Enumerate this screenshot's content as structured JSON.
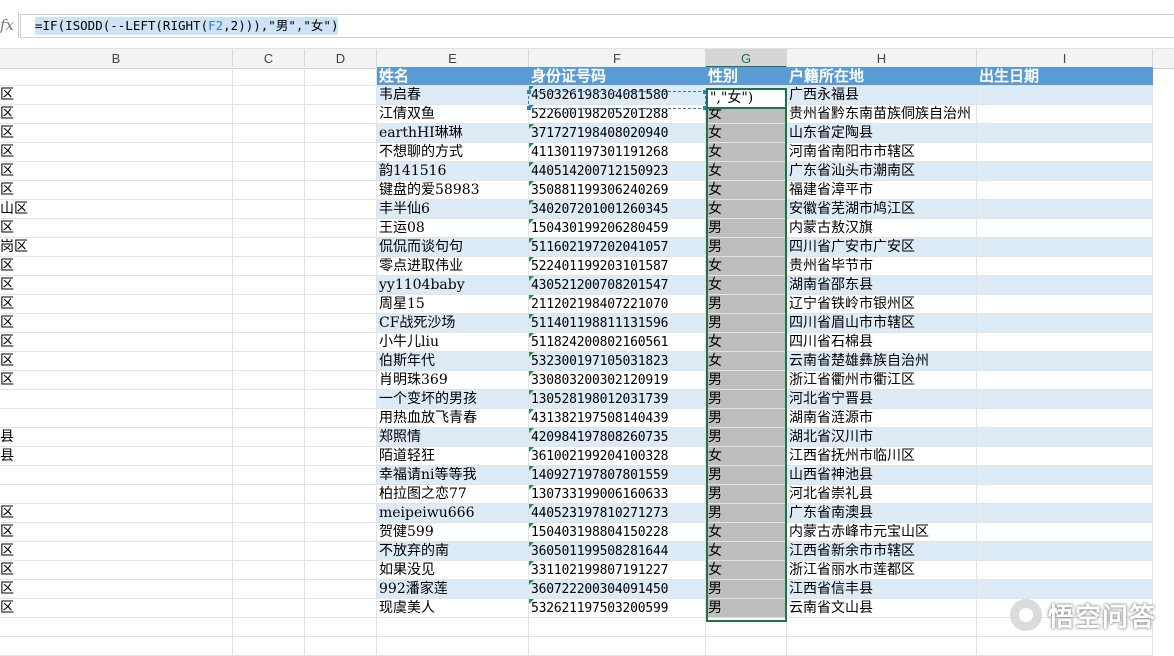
{
  "formula_bar": {
    "fx_label": "fx",
    "formula_prefix": "=IF(ISODD(--LEFT(RIGHT(",
    "formula_ref": "F2",
    "formula_mid": ",2))),\"男\",\"女\")"
  },
  "columns": [
    "B",
    "C",
    "D",
    "E",
    "F",
    "G",
    "H",
    "I"
  ],
  "selected_column": "G",
  "table": {
    "headers": [
      "姓名",
      "身份证号码",
      "性别",
      "户籍所在地",
      "出生日期"
    ],
    "active_cell_text": "\",\"女\")",
    "rows": [
      {
        "name": "韦启春",
        "id": "450326198304081580",
        "sex": "",
        "place": "广西永福县"
      },
      {
        "name": "江倩双鱼",
        "id": "522600198205201288",
        "sex": "女",
        "place": "贵州省黔东南苗族侗族自治州"
      },
      {
        "name": "earthHI琳琳",
        "id": "371727198408020940",
        "sex": "女",
        "place": "山东省定陶县"
      },
      {
        "name": "不想聊的方式",
        "id": "411301197301191268",
        "sex": "女",
        "place": "河南省南阳市市辖区"
      },
      {
        "name": "韵141516",
        "id": "440514200712150923",
        "sex": "女",
        "place": "广东省汕头市潮南区"
      },
      {
        "name": "键盘的爱58983",
        "id": "350881199306240269",
        "sex": "女",
        "place": "福建省漳平市"
      },
      {
        "name": "丰半仙6",
        "id": "340207201001260345",
        "sex": "女",
        "place": "安徽省芜湖市鸠江区"
      },
      {
        "name": "王运08",
        "id": "150430199206280459",
        "sex": "男",
        "place": "内蒙古敖汉旗"
      },
      {
        "name": "侃侃而谈句句",
        "id": "511602197202041057",
        "sex": "男",
        "place": "四川省广安市广安区"
      },
      {
        "name": "零点进取伟业",
        "id": "522401199203101587",
        "sex": "女",
        "place": "贵州省毕节市"
      },
      {
        "name": "yy1104baby",
        "id": "430521200708201547",
        "sex": "女",
        "place": "湖南省邵东县"
      },
      {
        "name": "周星15",
        "id": "211202198407221070",
        "sex": "男",
        "place": "辽宁省铁岭市银州区"
      },
      {
        "name": "CF战死沙场",
        "id": "511401198811131596",
        "sex": "男",
        "place": "四川省眉山市市辖区"
      },
      {
        "name": "小牛儿liu",
        "id": "511824200802160561",
        "sex": "女",
        "place": "四川省石棉县"
      },
      {
        "name": "伯斯年代",
        "id": "532300197105031823",
        "sex": "女",
        "place": "云南省楚雄彝族自治州"
      },
      {
        "name": "肖明珠369",
        "id": "330803200302120919",
        "sex": "男",
        "place": "浙江省衢州市衢江区"
      },
      {
        "name": "一个变坏的男孩",
        "id": "130528198012031739",
        "sex": "男",
        "place": "河北省宁晋县"
      },
      {
        "name": "用热血放飞青春",
        "id": "431382197508140439",
        "sex": "男",
        "place": "湖南省涟源市"
      },
      {
        "name": "郑照情",
        "id": "420984197808260735",
        "sex": "男",
        "place": "湖北省汉川市"
      },
      {
        "name": "陌道轻狂",
        "id": "361002199204100328",
        "sex": "女",
        "place": "江西省抚州市临川区"
      },
      {
        "name": "幸福请ni等等我",
        "id": "140927197807801559",
        "sex": "男",
        "place": "山西省神池县"
      },
      {
        "name": "柏拉图之恋77",
        "id": "130733199006160633",
        "sex": "男",
        "place": "河北省崇礼县"
      },
      {
        "name": "meipeiwu666",
        "id": "440523197810271273",
        "sex": "男",
        "place": "广东省南澳县"
      },
      {
        "name": "贺健599",
        "id": "150403198804150228",
        "sex": "女",
        "place": "内蒙古赤峰市元宝山区"
      },
      {
        "name": "不放弃的南",
        "id": "360501199508281644",
        "sex": "女",
        "place": "江西省新余市市辖区"
      },
      {
        "name": "如果没见",
        "id": "331102199807191227",
        "sex": "女",
        "place": "浙江省丽水市莲都区"
      },
      {
        "name": "992潘家莲",
        "id": "360722200304091450",
        "sex": "男",
        "place": "江西省信丰县"
      },
      {
        "name": "现虞美人",
        "id": "532621197503200599",
        "sex": "男",
        "place": "云南省文山县"
      }
    ]
  },
  "column_b_fragments": [
    "区",
    "区",
    "区",
    "区",
    "区",
    "区",
    "山区",
    "区",
    "岗区",
    "区",
    "区",
    "区",
    "区",
    "区",
    "区",
    "区",
    "",
    "",
    "县",
    "县",
    "",
    "",
    "区",
    "区",
    "区",
    "区",
    "区",
    "区"
  ],
  "watermark": {
    "text": "悟空问答"
  }
}
